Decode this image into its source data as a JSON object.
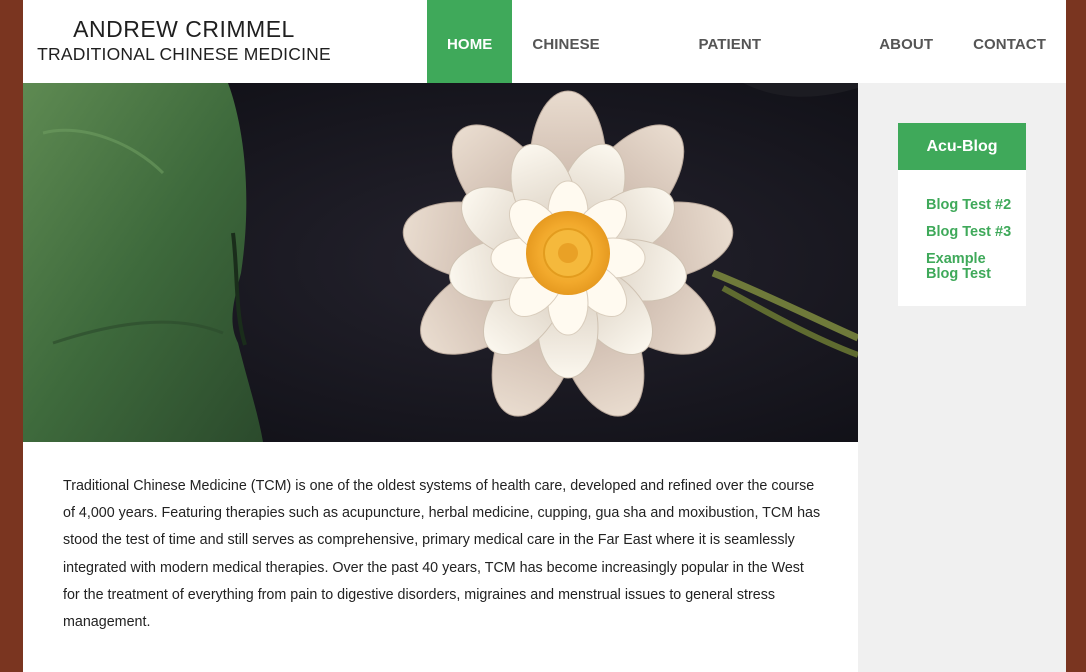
{
  "site": {
    "name": "ANDREW CRIMMEL",
    "tagline": "TRADITIONAL CHINESE MEDICINE"
  },
  "nav": {
    "items": [
      {
        "label": "HOME",
        "active": true
      },
      {
        "label": "CHINESE MEDICINE"
      },
      {
        "label": "PATIENT RESOURCES"
      },
      {
        "label": "ABOUT"
      },
      {
        "label": "CONTACT"
      }
    ]
  },
  "hero": {
    "icon": "water-lily-photo"
  },
  "main": {
    "intro": "Traditional Chinese Medicine (TCM) is one of the oldest systems of health care, developed and refined over the course of 4,000 years. Featuring therapies such as acupuncture, herbal medicine, cupping, gua sha and moxibustion, TCM has stood the test of time and still serves as comprehensive, primary medical care in the Far East where it is seamlessly integrated with modern medical therapies. Over the past 40 years, TCM has become increasingly popular in the West for the treatment of everything from pain to digestive disorders, migraines and menstrual issues to general stress management."
  },
  "sidebar": {
    "title": "Acu-Blog",
    "links": [
      {
        "label": "Blog Test #2"
      },
      {
        "label": "Blog Test #3"
      },
      {
        "label": "Example Blog Test"
      }
    ]
  },
  "colors": {
    "accent": "#3fa95a",
    "frame": "#7a3520",
    "sidebar_bg": "#f0f0f0"
  }
}
